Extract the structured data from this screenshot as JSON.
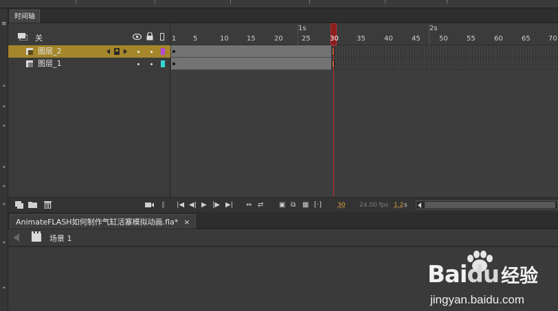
{
  "panel": {
    "title": "时间轴"
  },
  "header": {
    "scene_label": "关"
  },
  "layers": [
    {
      "name": "图层_2",
      "selected": true,
      "color": "#b24ad6"
    },
    {
      "name": "图层_1",
      "selected": false,
      "color": "#35d6d6"
    }
  ],
  "ruler": {
    "frame_labels": [
      "1",
      "5",
      "10",
      "15",
      "20",
      "25",
      "30",
      "35",
      "40",
      "45",
      "50",
      "55",
      "60",
      "65",
      "70"
    ],
    "second_labels": [
      "1s",
      "2s"
    ]
  },
  "playhead": {
    "frame": "30"
  },
  "status": {
    "current_frame": "30",
    "frame_rate": "24.00 fps",
    "elapsed": "1.2",
    "elapsed_unit": "s"
  },
  "document": {
    "tab_label": "AnimateFLASH如何制作气缸活塞模拟动画.fla*",
    "close": "×"
  },
  "breadcrumb": {
    "scene": "场景 1"
  },
  "watermark": {
    "logo_bai": "Bai",
    "logo_du": "du",
    "logo_jingyan": "经验",
    "url": "jingyan.baidu.com"
  },
  "colors": {
    "selected_layer": "#a5862a",
    "playhead": "#c62a2a"
  }
}
